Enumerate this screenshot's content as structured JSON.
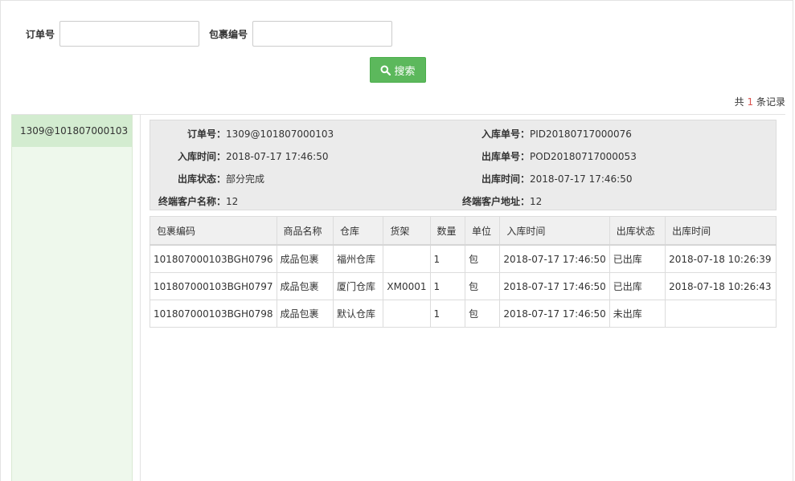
{
  "search": {
    "order_label": "订单号",
    "order_value": "",
    "parcel_label": "包裹编号",
    "parcel_value": "",
    "button_label": "搜索"
  },
  "records": {
    "prefix": "共",
    "count": "1",
    "suffix": "条记录"
  },
  "sidebar": {
    "items": [
      {
        "label": "1309@101807000103"
      }
    ]
  },
  "detail": {
    "order_no_label": "订单号：",
    "order_no": "1309@101807000103",
    "inbound_no_label": "入库单号：",
    "inbound_no": "PID20180717000076",
    "inbound_time_label": "入库时间：",
    "inbound_time": "2018-07-17 17:46:50",
    "outbound_no_label": "出库单号：",
    "outbound_no": "POD20180717000053",
    "outbound_status_label": "出库状态：",
    "outbound_status": "部分完成",
    "outbound_time_label": "出库时间：",
    "outbound_time": "2018-07-17 17:46:50",
    "customer_name_label": "终端客户名称：",
    "customer_name": "12",
    "customer_address_label": "终端客户地址：",
    "customer_address": "12"
  },
  "table": {
    "headers": [
      "包裹编码",
      "商品名称",
      "仓库",
      "货架",
      "数量",
      "单位",
      "入库时间",
      "出库状态",
      "出库时间"
    ],
    "rows": [
      [
        "101807000103BGH0796",
        "成品包裹",
        "福州仓库",
        "",
        "1",
        "包",
        "2018-07-17 17:46:50",
        "已出库",
        "2018-07-18 10:26:39"
      ],
      [
        "101807000103BGH0797",
        "成品包裹",
        "厦门仓库",
        "XM0001",
        "1",
        "包",
        "2018-07-17 17:46:50",
        "已出库",
        "2018-07-18 10:26:43"
      ],
      [
        "101807000103BGH0798",
        "成品包裹",
        "默认仓库",
        "",
        "1",
        "包",
        "2018-07-17 17:46:50",
        "未出库",
        ""
      ]
    ]
  }
}
